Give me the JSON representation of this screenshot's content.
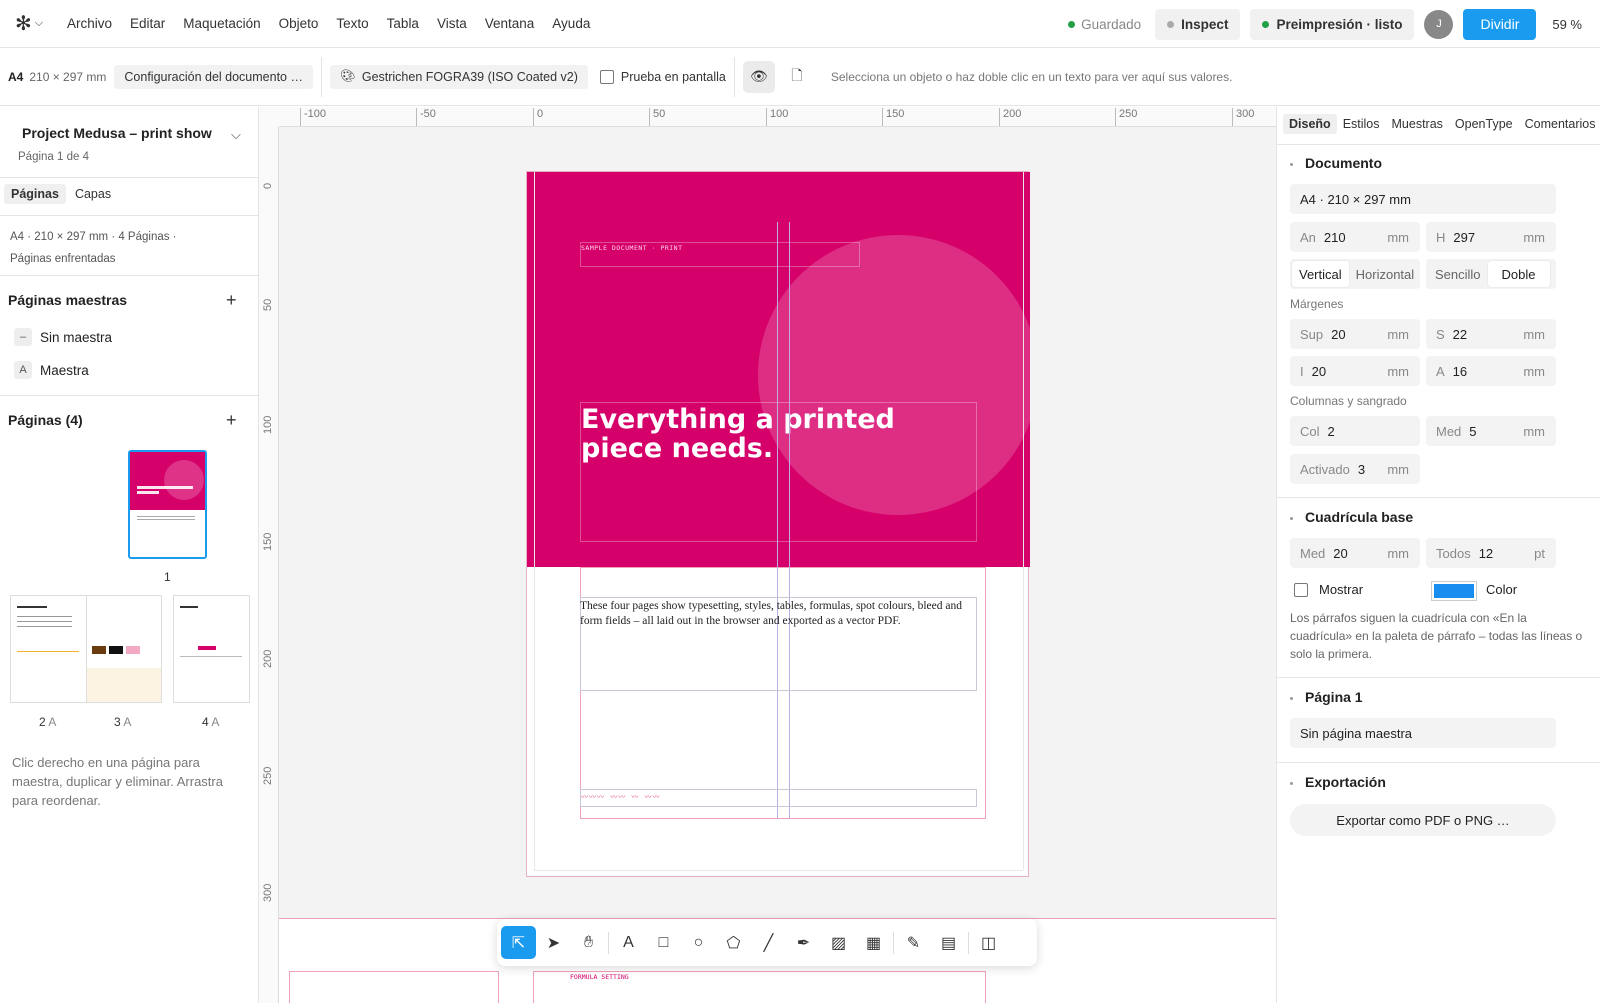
{
  "menubar": {
    "logo_icon": "gear-logo-icon",
    "items": [
      "Archivo",
      "Editar",
      "Maquetación",
      "Objeto",
      "Texto",
      "Tabla",
      "Vista",
      "Ventana",
      "Ayuda"
    ],
    "saved": "Guardado",
    "inspect": "Inspect",
    "preflight": "Preimpresión · listo",
    "avatar": "J",
    "share": "Dividir",
    "zoom": "59 %",
    "colors": {
      "saved_dot": "#22a046",
      "inspect_dot": "#aaaaaa",
      "preflight_dot": "#22a046",
      "primary": "#1a9bf0"
    }
  },
  "toolbar": {
    "size_name": "A4",
    "size_dims": "210 × 297 mm",
    "doc_setup": "Configuración del documento …",
    "color_profile": "Gestrichen FOGRA39 (ISO Coated v2)",
    "soft_proof": "Prueba en pantalla",
    "hint": "Selecciona un objeto o haz doble clic en un texto para ver aquí sus valores."
  },
  "left": {
    "project": "Project Medusa – print showcase",
    "page_of": "Página 1 de 4",
    "tabs": [
      "Páginas",
      "Capas"
    ],
    "meta1": "A4 · 210 × 297 mm  · 4 Páginas ·",
    "meta2": "Páginas enfrentadas",
    "masters_title": "Páginas maestras",
    "masters": [
      {
        "badge": "–",
        "label": "Sin maestra"
      },
      {
        "badge": "A",
        "label": "Maestra"
      }
    ],
    "pages_title": "Páginas (4)",
    "pages": [
      {
        "num": "1",
        "master": ""
      },
      {
        "num": "2",
        "master": "A"
      },
      {
        "num": "3",
        "master": "A"
      },
      {
        "num": "4",
        "master": "A"
      }
    ],
    "footer": "Clic derecho en una página para maestra, duplicar y eliminar. Arrastra para reordenar."
  },
  "canvas": {
    "ruler_top": [
      "-100",
      "-50",
      "0",
      "50",
      "100",
      "150",
      "200",
      "250",
      "300"
    ],
    "ruler_left": [
      "0",
      "50",
      "100",
      "150",
      "200",
      "250",
      "300"
    ],
    "eyebrow": "SAMPLE DOCUMENT · PRINT",
    "headline": "Everything a printed piece needs.",
    "body": "These four pages show typesetting, styles, tables, formulas, spot colours, bleed and form fields – all laid out in the browser and exported as a vector PDF.",
    "page2_label": "FORMULA SETTING",
    "hero_color": "#d6006a"
  },
  "right": {
    "tabs": [
      "Diseño",
      "Estilos",
      "Muestras",
      "OpenType",
      "Comentarios"
    ],
    "documento": {
      "title": "Documento",
      "size": "A4 · 210 × 297 mm",
      "width_lbl": "An",
      "width": "210",
      "height_lbl": "H",
      "height": "297",
      "unit": "mm",
      "orient": [
        "Vertical",
        "Horizontal"
      ],
      "sides": [
        "Sencillo",
        "Doble"
      ],
      "margins_lbl": "Márgenes",
      "top_lbl": "Sup",
      "top": "20",
      "s_lbl": "S",
      "s": "22",
      "i_lbl": "I",
      "i": "20",
      "a_lbl": "A",
      "a": "16",
      "cols_lbl": "Columnas y sangrado",
      "col_lbl": "Col",
      "col": "2",
      "gutter_lbl": "Med",
      "gutter": "5",
      "bleed_lbl": "Activado",
      "bleed": "3"
    },
    "grid": {
      "title": "Cuadrícula base",
      "med_lbl": "Med",
      "med": "20",
      "med_unit": "mm",
      "all_lbl": "Todos",
      "all": "12",
      "all_unit": "pt",
      "show": "Mostrar",
      "color_lbl": "Color",
      "swatch": "#1a8ef0",
      "note": "Los párrafos siguen la cuadrícula con «En la cuadrícula» en la paleta de párrafo – todas las líneas o solo la primera."
    },
    "page": {
      "title": "Página 1",
      "master": "Sin página maestra"
    },
    "export": {
      "title": "Exportación",
      "button": "Exportar como PDF o PNG …"
    }
  }
}
